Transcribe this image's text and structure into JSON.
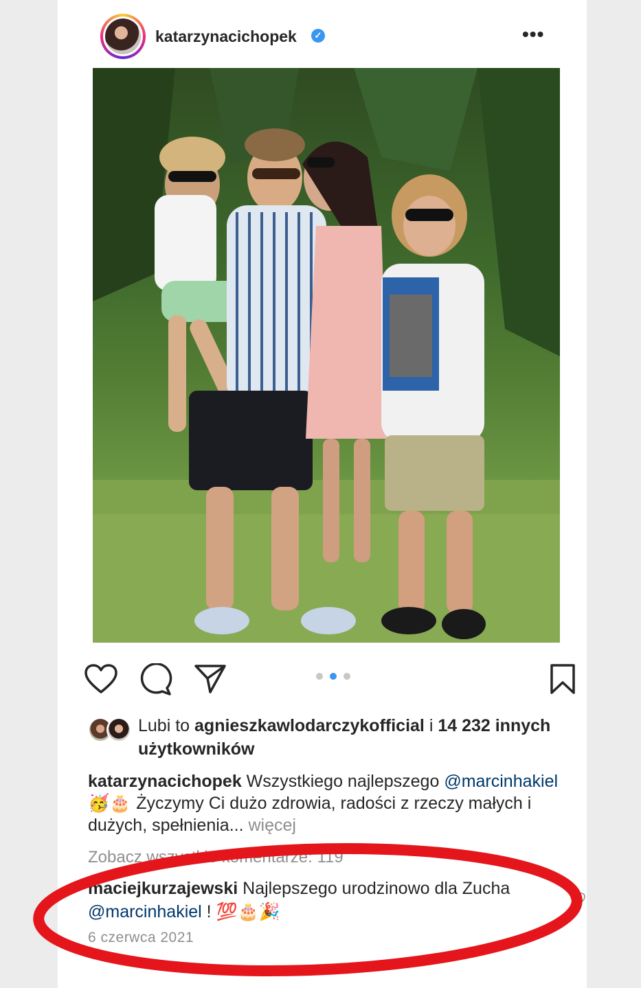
{
  "post": {
    "username": "katarzynacichopek",
    "verified_badge": "✓",
    "more_menu": "•••"
  },
  "photo": {
    "alt": "family photo"
  },
  "actions": {
    "icons": [
      "heart-icon",
      "comment-icon",
      "share-icon",
      "bookmark-icon"
    ],
    "carousel_dots": 3,
    "active_dot": 2
  },
  "likes": {
    "prefix": "Lubi to ",
    "user": "agnieszkawlodarczykofficial",
    "middle": " i ",
    "count_text": "14 232 innych użytkowników"
  },
  "caption": {
    "username": "katarzynacichopek",
    "text1": " Wszystkiego najlepszego ",
    "mention": "@marcinhakiel",
    "emoji": " 🥳🎂 ",
    "text2": "Życzymy Ci dużo zdrowia, radości z rzeczy małych i dużych, spełnienia...",
    "more": " więcej"
  },
  "view_comments": "Zobacz wszystkie komentarze: 119",
  "comment": {
    "username": "maciejkurzajewski",
    "text1": " Najlepszego urodzinowo dla Zucha ",
    "mention": "@marcinhakiel",
    "text2": " ! ",
    "emoji": "💯🎂🎉"
  },
  "date": "6 czerwca 2021",
  "colors": {
    "highlight": "#e4161b",
    "link": "#00376b",
    "muted": "#8e8e8e",
    "active_dot": "#3897f0"
  }
}
